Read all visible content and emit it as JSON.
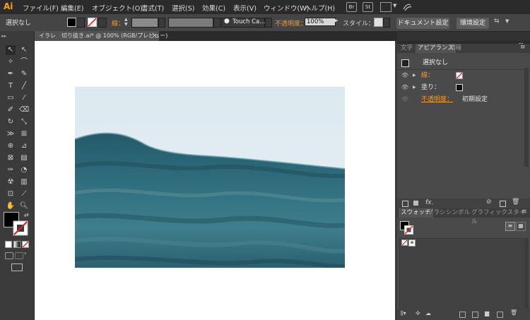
{
  "menubar": {
    "logo": "Ai",
    "items": [
      "ファイル(F)",
      "編集(E)",
      "オブジェクト(O)",
      "書式(T)",
      "選択(S)",
      "効果(C)",
      "表示(V)",
      "ウィンドウ(W)",
      "ヘルプ(H)"
    ],
    "icons": [
      "Br",
      "St"
    ]
  },
  "control_bar": {
    "selection": "選択なし",
    "stroke_label": "線：",
    "brush_name": "Touch Ca...",
    "opacity_label": "不透明度：",
    "opacity_value": "100%",
    "style_label": "スタイル：",
    "doc_setup_button": "ドキュメント設定",
    "prefs_button": "環境設定"
  },
  "document_tab": {
    "title": "イラレ　切り抜き.ai* @ 100% (RGB/プレビュー)",
    "close": "×"
  },
  "appearance_panel": {
    "tabs": [
      "文字",
      "アピアランス",
      "情報"
    ],
    "active_tab": "アピアランス",
    "header": "選択なし",
    "stroke_label": "線：",
    "fill_label": "塗り：",
    "opacity_label": "不透明度：",
    "opacity_value": "初期設定",
    "fx": "fx."
  },
  "swatches_panel": {
    "tabs": [
      "スウォッチ",
      "ブラシ",
      "シンボル",
      "グラフィックスタイル"
    ],
    "active_tab": "スウォッチ"
  },
  "colors": {
    "accent_orange": "#f29b2c",
    "ui_dark": "#323232",
    "canvas": "#ffffff"
  }
}
